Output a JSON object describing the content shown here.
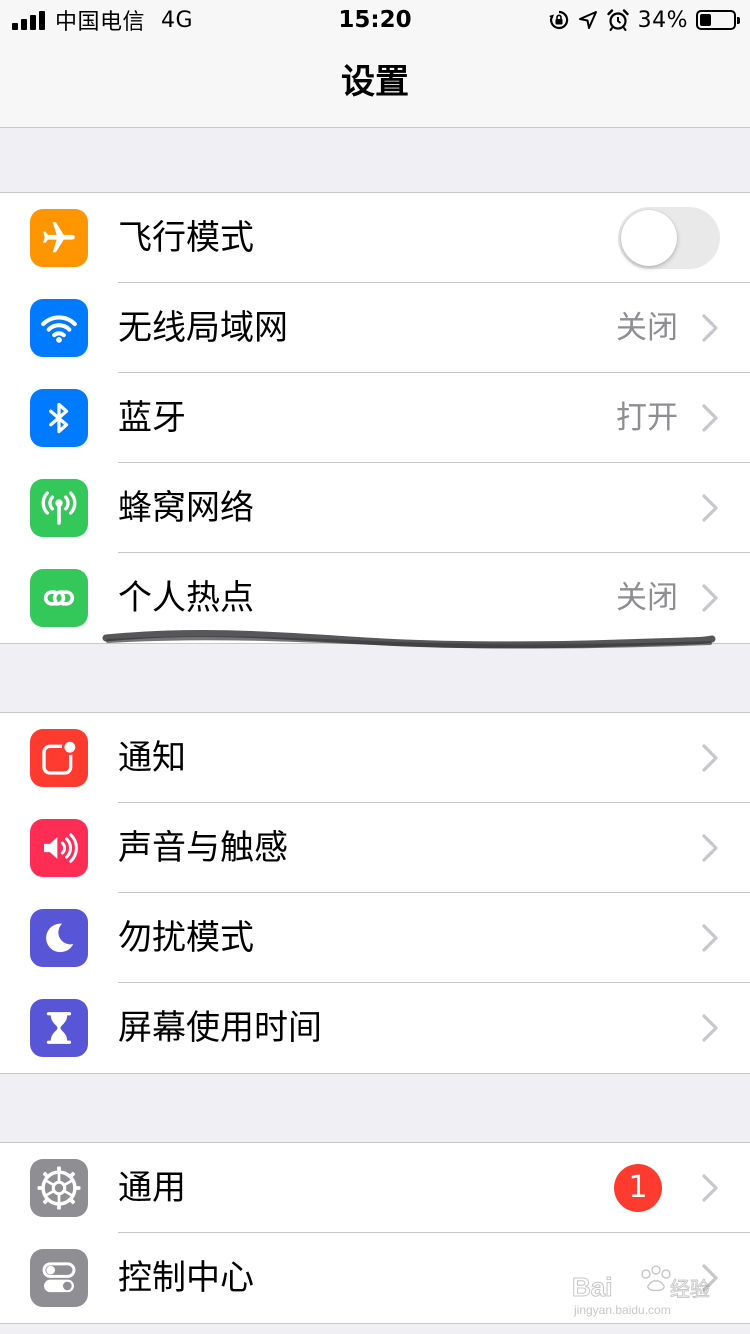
{
  "status_bar": {
    "carrier": "中国电信",
    "network": "4G",
    "time": "15:20",
    "battery_percent": "34%",
    "battery_level": 0.34,
    "icons": [
      "rotation-lock-icon",
      "location-icon",
      "alarm-icon",
      "battery-icon"
    ]
  },
  "nav": {
    "title": "设置"
  },
  "groups": [
    {
      "items": [
        {
          "label": "飞行模式",
          "icon": "airplane-icon",
          "color": "#ff9500",
          "accessory": "toggle",
          "toggle_on": false
        },
        {
          "label": "无线局域网",
          "icon": "wifi-icon",
          "color": "#007aff",
          "value": "关闭"
        },
        {
          "label": "蓝牙",
          "icon": "bluetooth-icon",
          "color": "#007aff",
          "value": "打开"
        },
        {
          "label": "蜂窝网络",
          "icon": "cellular-icon",
          "color": "#34c759"
        },
        {
          "label": "个人热点",
          "icon": "hotspot-icon",
          "color": "#34c759",
          "value": "关闭"
        }
      ]
    },
    {
      "items": [
        {
          "label": "通知",
          "icon": "notifications-icon",
          "color": "#ff3b30"
        },
        {
          "label": "声音与触感",
          "icon": "sound-icon",
          "color": "#ff2d55"
        },
        {
          "label": "勿扰模式",
          "icon": "moon-icon",
          "color": "#5856d6"
        },
        {
          "label": "屏幕使用时间",
          "icon": "hourglass-icon",
          "color": "#5856d6"
        }
      ]
    },
    {
      "items": [
        {
          "label": "通用",
          "icon": "gear-icon",
          "color": "#8e8e93",
          "badge": "1"
        },
        {
          "label": "控制中心",
          "icon": "switches-icon",
          "color": "#8e8e93"
        }
      ]
    }
  ],
  "watermark": {
    "brand": "Baidu经验",
    "url": "jingyan.baidu.com"
  }
}
